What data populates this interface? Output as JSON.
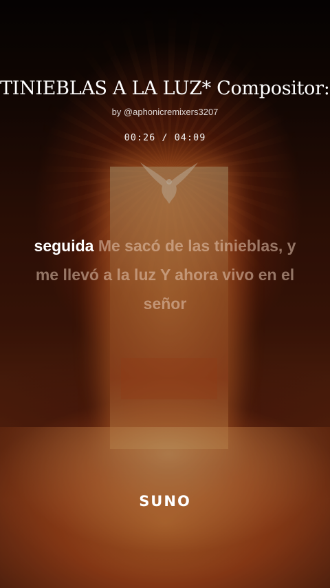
{
  "song": {
    "title": "TINIEBLAS A LA LUZ* Compositor: José",
    "byline": "by @aphonicremixers3207",
    "time": "00:26 / 04:09"
  },
  "lyrics": {
    "active": "seguida",
    "upcoming": "Me sacó de las tinieblas, y me llevó a la luz Y ahora vivo en el señor"
  },
  "branding": {
    "logo": "SUNO"
  },
  "icons": {
    "artwork": "dove-over-lit-doorway"
  }
}
